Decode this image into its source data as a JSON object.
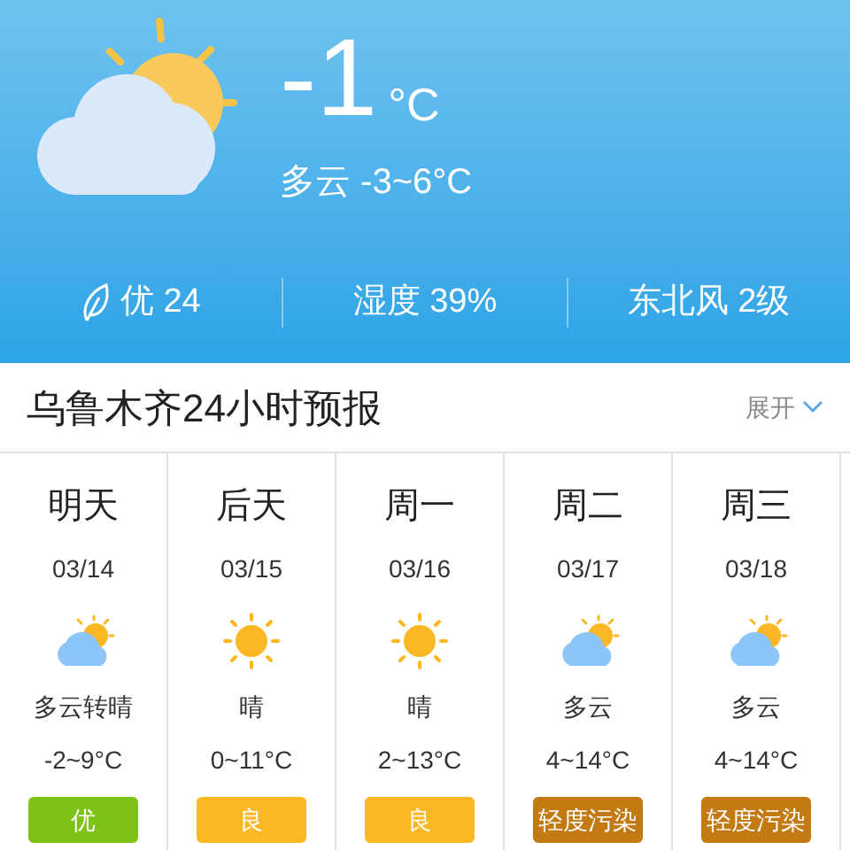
{
  "current": {
    "temperature": "-1",
    "unit": "°C",
    "summary": "多云 -3~6°C"
  },
  "stats": [
    {
      "kind": "air",
      "text": "优 24"
    },
    {
      "kind": "plain",
      "text": "湿度 39%"
    },
    {
      "kind": "plain",
      "text": "东北风 2级"
    }
  ],
  "forecast_header": {
    "title": "乌鲁木齐24小时预报",
    "toggle": "展开"
  },
  "days": [
    {
      "day": "明天",
      "date": "03/14",
      "kind": "cloud-sun",
      "weather": "多云转晴",
      "temp": "-2~9°C",
      "aqi": "优",
      "color": "#7cc315"
    },
    {
      "day": "后天",
      "date": "03/15",
      "kind": "sun",
      "weather": "晴",
      "temp": "0~11°C",
      "aqi": "良",
      "color": "#fbb724"
    },
    {
      "day": "周一",
      "date": "03/16",
      "kind": "sun",
      "weather": "晴",
      "temp": "2~13°C",
      "aqi": "良",
      "color": "#fbb724"
    },
    {
      "day": "周二",
      "date": "03/17",
      "kind": "cloud-sun",
      "weather": "多云",
      "temp": "4~14°C",
      "aqi": "轻度污染",
      "color": "#c47a12"
    },
    {
      "day": "周三",
      "date": "03/18",
      "kind": "cloud-sun",
      "weather": "多云",
      "temp": "4~14°C",
      "aqi": "轻度污染",
      "color": "#c47a12"
    }
  ]
}
